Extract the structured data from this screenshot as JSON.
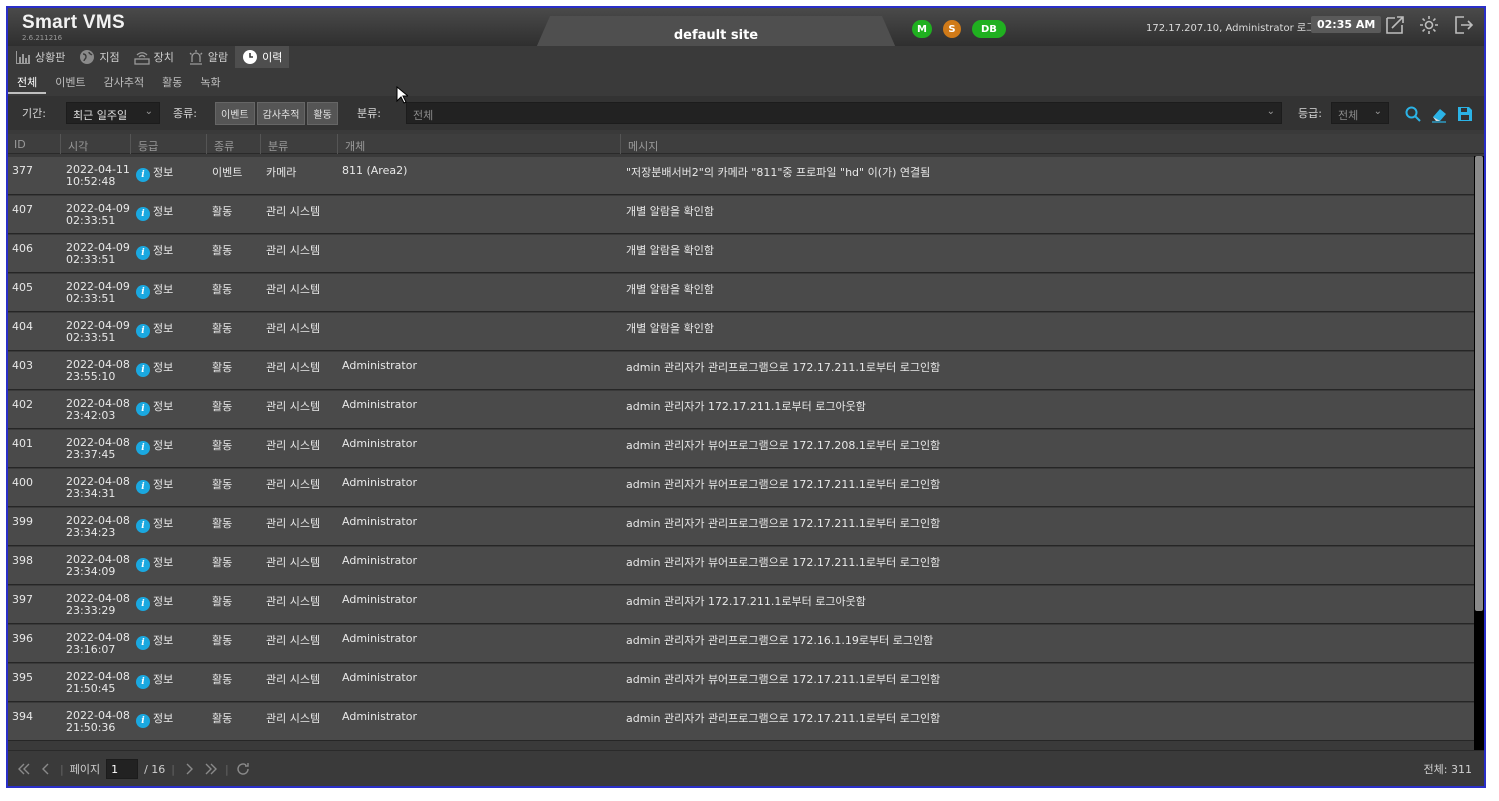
{
  "app": {
    "name": "Smart VMS",
    "version": "2.6.211216"
  },
  "header": {
    "site": "default site",
    "badges": [
      "M",
      "S",
      "DB"
    ],
    "login_info": "172.17.207.10, Administrator 로그인",
    "clock": "02:35 AM"
  },
  "mainnav": {
    "items": [
      {
        "label": "상황판",
        "icon": "bar-chart-icon"
      },
      {
        "label": "지점",
        "icon": "globe-icon"
      },
      {
        "label": "장치",
        "icon": "device-icon"
      },
      {
        "label": "알람",
        "icon": "alarm-icon"
      },
      {
        "label": "이력",
        "icon": "clock-icon"
      }
    ]
  },
  "subtabs": [
    "전체",
    "이벤트",
    "감사추적",
    "활동",
    "녹화"
  ],
  "filters": {
    "period_label": "기간:",
    "period_value": "최근 일주일",
    "type_label": "종류:",
    "type_buttons": [
      "이벤트",
      "감사추적",
      "활동"
    ],
    "category_label": "분류:",
    "category_value": "전체",
    "grade_label": "등급:",
    "grade_value": "전체"
  },
  "table": {
    "columns": [
      "ID",
      "시각",
      "등급",
      "종류",
      "분류",
      "개체",
      "메시지"
    ],
    "rows": [
      {
        "id": "377",
        "date": "2022-04-11",
        "time": "10:52:48",
        "grade": "정보",
        "kind": "이벤트",
        "category": "카메라",
        "object": "811 (Area2)",
        "message": "\"저장분배서버2\"의 카메라 \"811\"중 프로파일 \"hd\" 이(가) 연결됨"
      },
      {
        "id": "407",
        "date": "2022-04-09",
        "time": "02:33:51",
        "grade": "정보",
        "kind": "활동",
        "category": "관리 시스템",
        "object": "",
        "message": "개별 알람을 확인함"
      },
      {
        "id": "406",
        "date": "2022-04-09",
        "time": "02:33:51",
        "grade": "정보",
        "kind": "활동",
        "category": "관리 시스템",
        "object": "",
        "message": "개별 알람을 확인함"
      },
      {
        "id": "405",
        "date": "2022-04-09",
        "time": "02:33:51",
        "grade": "정보",
        "kind": "활동",
        "category": "관리 시스템",
        "object": "",
        "message": "개별 알람을 확인함"
      },
      {
        "id": "404",
        "date": "2022-04-09",
        "time": "02:33:51",
        "grade": "정보",
        "kind": "활동",
        "category": "관리 시스템",
        "object": "",
        "message": "개별 알람을 확인함"
      },
      {
        "id": "403",
        "date": "2022-04-08",
        "time": "23:55:10",
        "grade": "정보",
        "kind": "활동",
        "category": "관리 시스템",
        "object": "Administrator",
        "message": "admin 관리자가 관리프로그램으로 172.17.211.1로부터 로그인함"
      },
      {
        "id": "402",
        "date": "2022-04-08",
        "time": "23:42:03",
        "grade": "정보",
        "kind": "활동",
        "category": "관리 시스템",
        "object": "Administrator",
        "message": "admin 관리자가 172.17.211.1로부터 로그아웃함"
      },
      {
        "id": "401",
        "date": "2022-04-08",
        "time": "23:37:45",
        "grade": "정보",
        "kind": "활동",
        "category": "관리 시스템",
        "object": "Administrator",
        "message": "admin 관리자가 뷰어프로그램으로 172.17.208.1로부터 로그인함"
      },
      {
        "id": "400",
        "date": "2022-04-08",
        "time": "23:34:31",
        "grade": "정보",
        "kind": "활동",
        "category": "관리 시스템",
        "object": "Administrator",
        "message": "admin 관리자가 뷰어프로그램으로 172.17.211.1로부터 로그인함"
      },
      {
        "id": "399",
        "date": "2022-04-08",
        "time": "23:34:23",
        "grade": "정보",
        "kind": "활동",
        "category": "관리 시스템",
        "object": "Administrator",
        "message": "admin 관리자가 관리프로그램으로 172.17.211.1로부터 로그인함"
      },
      {
        "id": "398",
        "date": "2022-04-08",
        "time": "23:34:09",
        "grade": "정보",
        "kind": "활동",
        "category": "관리 시스템",
        "object": "Administrator",
        "message": "admin 관리자가 뷰어프로그램으로 172.17.211.1로부터 로그인함"
      },
      {
        "id": "397",
        "date": "2022-04-08",
        "time": "23:33:29",
        "grade": "정보",
        "kind": "활동",
        "category": "관리 시스템",
        "object": "Administrator",
        "message": "admin 관리자가 172.17.211.1로부터 로그아웃함"
      },
      {
        "id": "396",
        "date": "2022-04-08",
        "time": "23:16:07",
        "grade": "정보",
        "kind": "활동",
        "category": "관리 시스템",
        "object": "Administrator",
        "message": "admin 관리자가 관리프로그램으로 172.16.1.19로부터 로그인함"
      },
      {
        "id": "395",
        "date": "2022-04-08",
        "time": "21:50:45",
        "grade": "정보",
        "kind": "활동",
        "category": "관리 시스템",
        "object": "Administrator",
        "message": "admin 관리자가 뷰어프로그램으로 172.17.211.1로부터 로그인함"
      },
      {
        "id": "394",
        "date": "2022-04-08",
        "time": "21:50:36",
        "grade": "정보",
        "kind": "활동",
        "category": "관리 시스템",
        "object": "Administrator",
        "message": "admin 관리자가 관리프로그램으로 172.17.211.1로부터 로그인함"
      }
    ]
  },
  "footer": {
    "page_label": "페이지",
    "page_value": "1",
    "page_total": "/ 16",
    "total": "전체: 311"
  },
  "colors": {
    "info": "#1aa8e0",
    "badge_green": "#20b020",
    "badge_orange": "#d07a18",
    "accent": "#2bb3e6"
  }
}
